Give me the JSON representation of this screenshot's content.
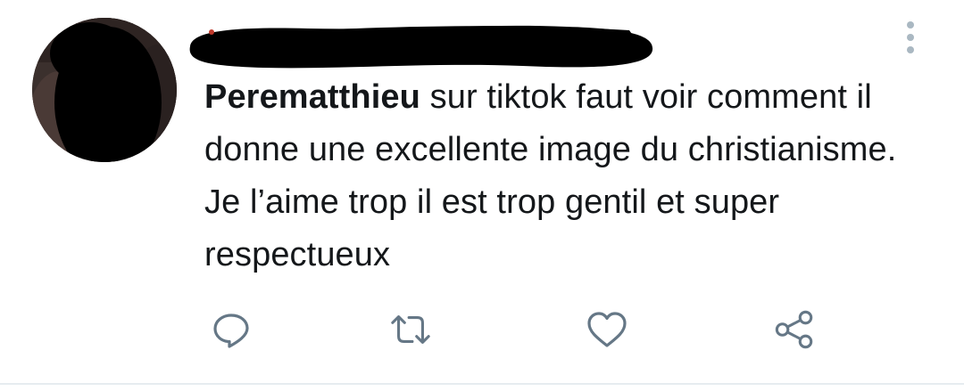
{
  "tweet": {
    "username": "Perematthieu",
    "text": " sur tiktok faut voir comment il donne une excellente image du christianisme. Je l’aime trop il est trop gentil et super respectueux"
  },
  "actions": {
    "reply_icon": "reply-icon",
    "retweet_icon": "retweet-icon",
    "like_icon": "heart-icon",
    "share_icon": "share-icon"
  },
  "colors": {
    "icon": "#657786",
    "text": "#14171a",
    "menu_dots": "#aab8c2",
    "redaction": "#000000"
  }
}
